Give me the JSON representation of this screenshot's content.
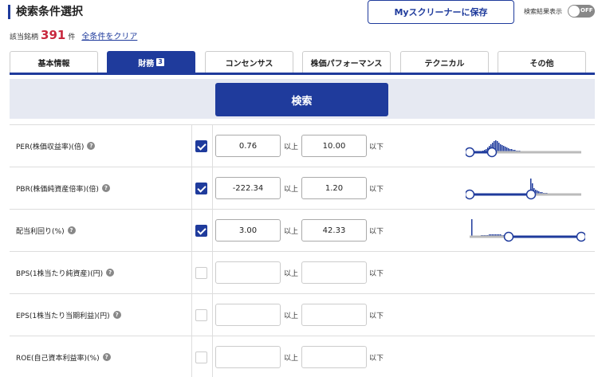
{
  "header": {
    "title": "検索条件選択",
    "save_label": "Myスクリーナーに保存",
    "result_display_label": "検索結果表示",
    "toggle_label": "OFF"
  },
  "summary": {
    "count_label": "該当銘柄",
    "count": "391",
    "count_unit": "件",
    "clear_label": "全条件をクリア"
  },
  "tabs": [
    {
      "label": "基本情報",
      "active": false
    },
    {
      "label": "財務",
      "badge": "3",
      "active": true
    },
    {
      "label": "コンセンサス",
      "active": false
    },
    {
      "label": "株価パフォーマンス",
      "active": false
    },
    {
      "label": "テクニカル",
      "active": false
    },
    {
      "label": "その他",
      "active": false
    }
  ],
  "search_label": "検索",
  "units": {
    "min": "以上",
    "max": "以下"
  },
  "criteria": [
    {
      "label": "PER(株価収益率)(倍)",
      "checked": true,
      "min": "0.76",
      "max": "10.00",
      "slider_min": 0.0,
      "slider_max": 0.2
    },
    {
      "label": "PBR(株価純資産倍率)(倍)",
      "checked": true,
      "min": "-222.34",
      "max": "1.20",
      "slider_min": 0.0,
      "slider_max": 0.55
    },
    {
      "label": "配当利回り(%)",
      "checked": true,
      "min": "3.00",
      "max": "42.33",
      "slider_min": 0.35,
      "slider_max": 1.0
    },
    {
      "label": "BPS(1株当たり純資産)(円)",
      "checked": false,
      "min": "",
      "max": ""
    },
    {
      "label": "EPS(1株当たり当期利益)(円)",
      "checked": false,
      "min": "",
      "max": ""
    },
    {
      "label": "ROE(自己資本利益率)(%)",
      "checked": false,
      "min": "",
      "max": ""
    }
  ],
  "colors": {
    "accent": "#1f3b9c",
    "count": "#c8283e"
  }
}
